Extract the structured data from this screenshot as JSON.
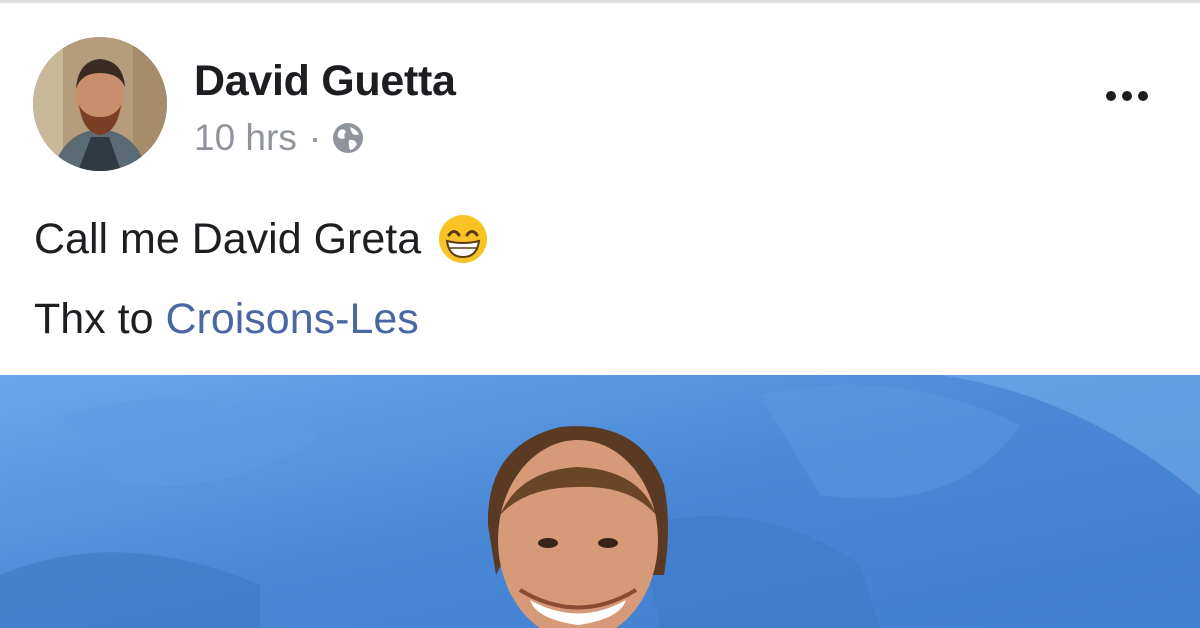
{
  "post": {
    "author": "David Guetta",
    "time": "10 hrs",
    "separator": "·",
    "privacy_icon": "globe-icon",
    "more_icon": "ellipsis-icon",
    "text_line": "Call me David Greta",
    "emoji": "grinning-face-icon",
    "thanks_prefix": "Thx to",
    "thanks_link": "Croisons-Les"
  },
  "colors": {
    "author": "#1c1e21",
    "meta": "#90949c",
    "link": "#4b67a1",
    "photo_bg": "#4a88d6"
  }
}
